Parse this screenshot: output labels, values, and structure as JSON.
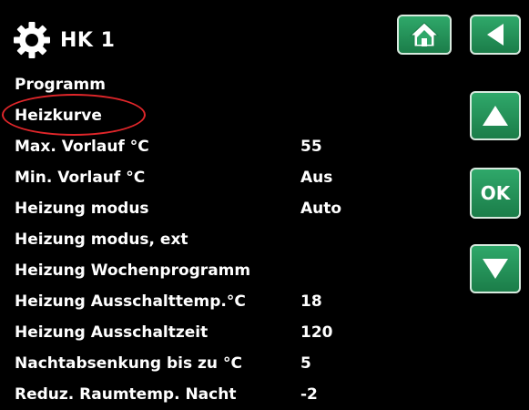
{
  "header": {
    "title": "HK 1"
  },
  "menu": {
    "items": [
      {
        "label": "Programm",
        "value": ""
      },
      {
        "label": "Heizkurve",
        "value": ""
      },
      {
        "label": "Max. Vorlauf °C",
        "value": "55"
      },
      {
        "label": "Min. Vorlauf °C",
        "value": "Aus"
      },
      {
        "label": "Heizung modus",
        "value": "Auto"
      },
      {
        "label": "Heizung modus, ext",
        "value": ""
      },
      {
        "label": "Heizung Wochenprogramm",
        "value": ""
      },
      {
        "label": "Heizung Ausschalttemp.°C",
        "value": "18"
      },
      {
        "label": "Heizung Ausschaltzeit",
        "value": "120"
      },
      {
        "label": "Nachtabsenkung bis zu °C",
        "value": "5"
      },
      {
        "label": "Reduz. Raumtemp. Nacht",
        "value": "-2"
      }
    ]
  },
  "buttons": {
    "home": "home-icon",
    "back": "back-arrow-icon",
    "up": "arrow-up-icon",
    "ok_label": "OK",
    "down": "arrow-down-icon"
  },
  "colors": {
    "background": "#000000",
    "button_green": "#239157",
    "highlight_ring": "#e0262a"
  }
}
